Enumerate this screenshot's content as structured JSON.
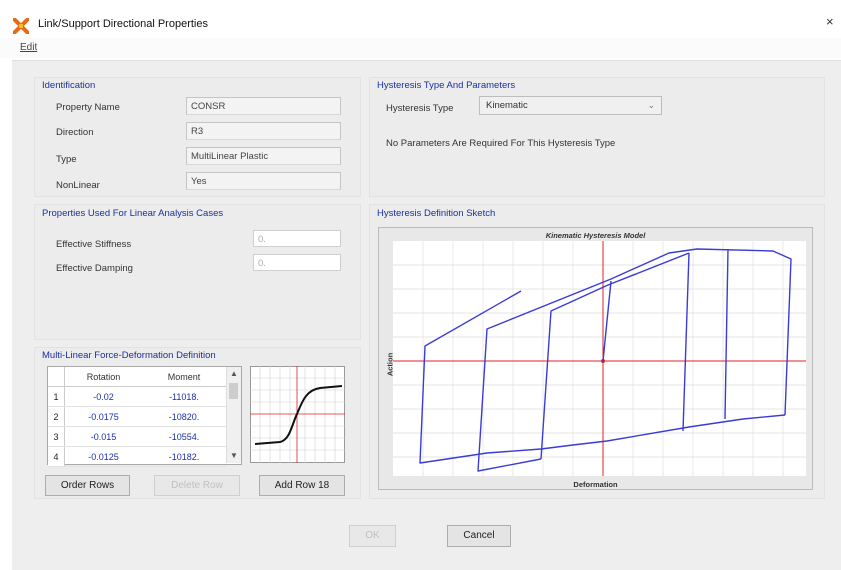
{
  "window": {
    "title": "Link/Support Directional Properties",
    "close_glyph": "×"
  },
  "menu": {
    "edit": "Edit"
  },
  "identification": {
    "title": "Identification",
    "fields": [
      {
        "label": "Property Name",
        "value": "CONSR"
      },
      {
        "label": "Direction",
        "value": "R3"
      },
      {
        "label": "Type",
        "value": "MultiLinear Plastic"
      },
      {
        "label": "NonLinear",
        "value": "Yes"
      }
    ]
  },
  "hysteresis": {
    "title": "Hysteresis Type And Parameters",
    "type_label": "Hysteresis Type",
    "type_value": "Kinematic",
    "note": "No Parameters Are Required For This Hysteresis Type"
  },
  "linear": {
    "title": "Properties Used For Linear Analysis Cases",
    "stiffness_label": "Effective Stiffness",
    "stiffness_value": "0.",
    "damping_label": "Effective Damping",
    "damping_value": "0."
  },
  "sketch": {
    "title": "Hysteresis Definition Sketch",
    "model_title": "Kinematic Hysteresis Model",
    "x_label": "Deformation",
    "y_label": "Action",
    "curve_color": "#3b3bd6",
    "axis_color": "#e02020"
  },
  "multilinear": {
    "title": "Multi-Linear Force-Deformation Definition",
    "columns": [
      "Rotation",
      "Moment"
    ],
    "rows": [
      {
        "n": "1",
        "rotation": "-0.02",
        "moment": "-11018."
      },
      {
        "n": "2",
        "rotation": "-0.0175",
        "moment": "-10820."
      },
      {
        "n": "3",
        "rotation": "-0.015",
        "moment": "-10554."
      },
      {
        "n": "4",
        "rotation": "-0.0125",
        "moment": "-10182."
      }
    ],
    "order_rows": "Order Rows",
    "delete_row": "Delete Row",
    "add_row": "Add Row 18"
  },
  "footer": {
    "ok": "OK",
    "cancel": "Cancel"
  }
}
